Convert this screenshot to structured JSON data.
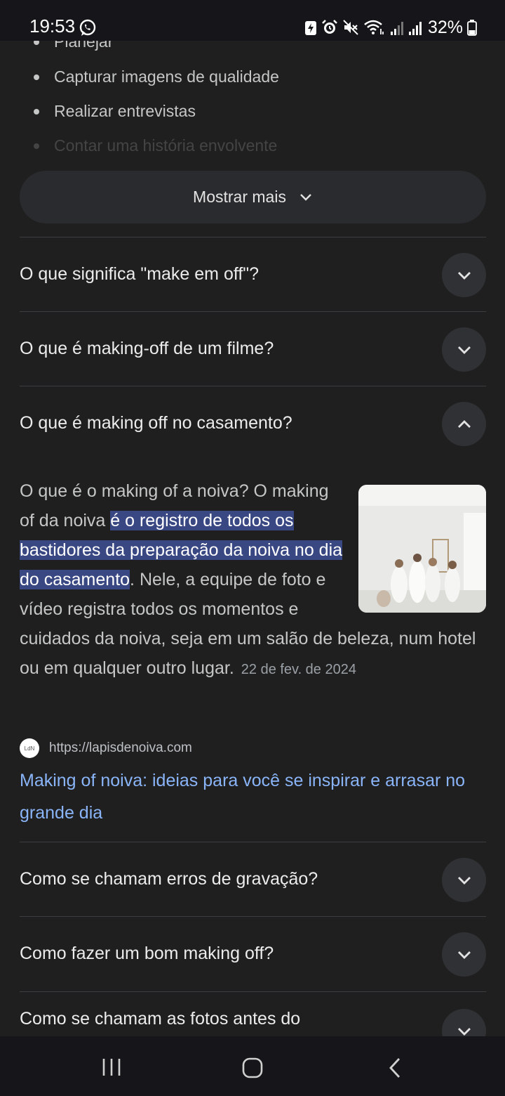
{
  "status_bar": {
    "time": "19:53",
    "battery": "32%"
  },
  "bullets": [
    {
      "text": "Planejar"
    },
    {
      "text": "Capturar imagens de qualidade"
    },
    {
      "text": "Realizar entrevistas"
    },
    {
      "text": "Contar uma história envolvente"
    }
  ],
  "show_more_label": "Mostrar mais",
  "faq": [
    {
      "question": "O que significa \"make em off\"?"
    },
    {
      "question": "O que é making-off de um filme?"
    },
    {
      "question": "O que é making off no casamento?"
    },
    {
      "question": "Como se chamam erros de gravação?"
    },
    {
      "question": "Como fazer um bom making off?"
    },
    {
      "question": "Como se chamam as fotos antes do casamento?"
    }
  ],
  "answer": {
    "before": "O que é o making of a noiva? O making of da noiva ",
    "highlight": "é o registro de todos os bastidores da preparação da noiva no dia do casamento",
    "after": ". Nele, a equipe de foto e vídeo registra todos os momentos e cuidados da noiva, seja em um salão de beleza, num hotel ou em qualquer outro lugar.",
    "date": "22 de fev. de 2024",
    "source_url": "https://lapisdenoiva.com",
    "link_title": "Making of noiva: ideias para você se inspirar e arrasar no grande dia"
  },
  "colors": {
    "background": "#1f1f1f",
    "highlight": "#394782",
    "link": "#8ab4f8"
  }
}
